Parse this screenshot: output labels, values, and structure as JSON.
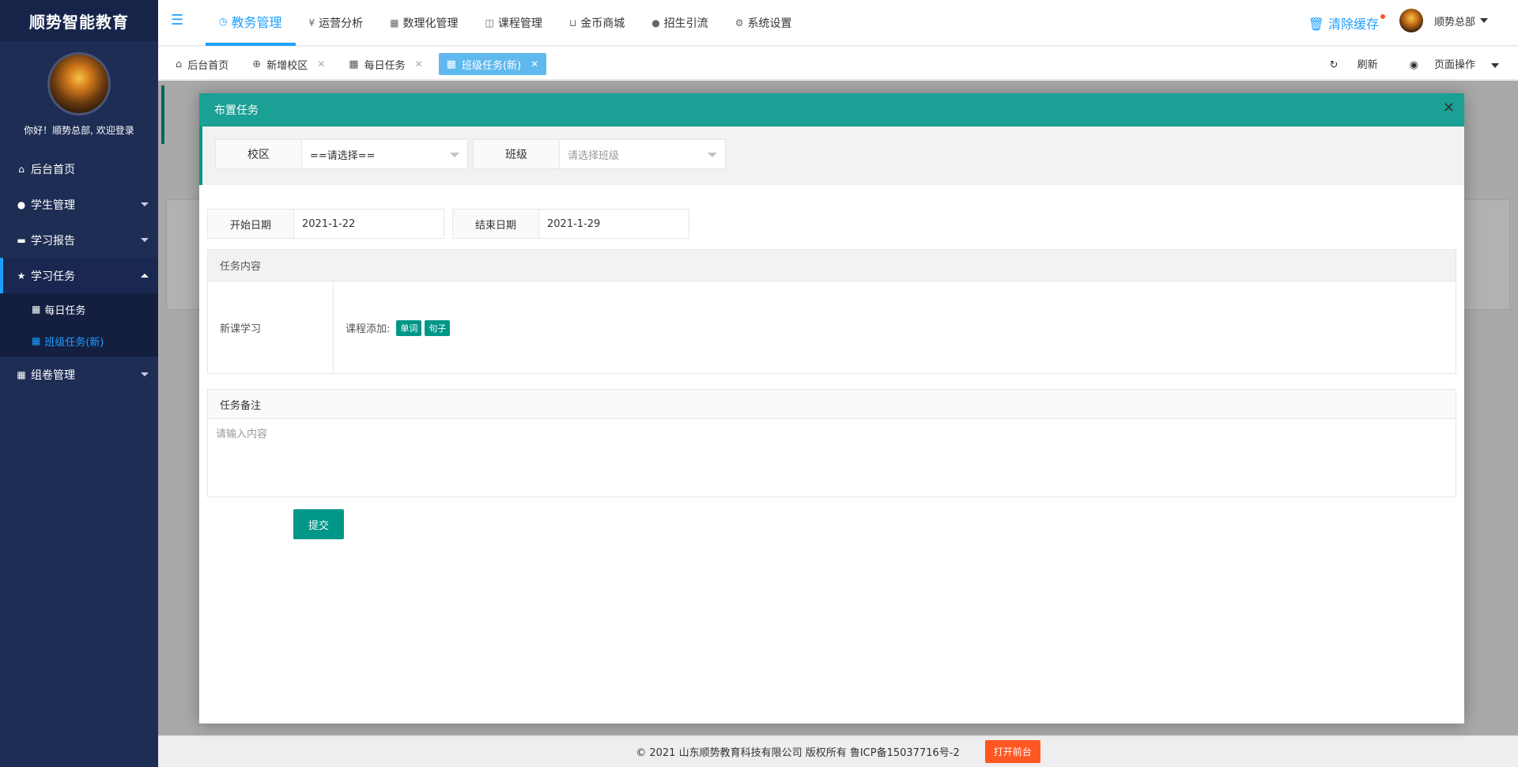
{
  "brand": "顺势智能教育",
  "welcome": "你好！顺势总部, 欢迎登录",
  "sidebar": {
    "items": [
      {
        "icon": "home-icon",
        "label": "后台首页"
      },
      {
        "icon": "user-icon",
        "label": "学生管理"
      },
      {
        "icon": "report-icon",
        "label": "学习报告"
      },
      {
        "icon": "star-icon",
        "label": "学习任务"
      },
      {
        "icon": "grid-icon",
        "label": "组卷管理"
      }
    ],
    "subitems": [
      {
        "icon": "grid-icon",
        "label": "每日任务"
      },
      {
        "icon": "grid-icon",
        "label": "班级任务(新)"
      }
    ]
  },
  "topnav": {
    "items": [
      {
        "icon": "clock-icon",
        "label": "教务管理"
      },
      {
        "icon": "yen-icon",
        "label": "运营分析"
      },
      {
        "icon": "grid-icon",
        "label": "数理化管理"
      },
      {
        "icon": "book-icon",
        "label": "课程管理"
      },
      {
        "icon": "cart-icon",
        "label": "金币商城"
      },
      {
        "icon": "users-icon",
        "label": "招生引流"
      },
      {
        "icon": "gear-icon",
        "label": "系统设置"
      }
    ],
    "clear_cache": "清除缓存",
    "user_name": "顺势总部"
  },
  "tabs": [
    {
      "icon": "home-icon",
      "label": "后台首页"
    },
    {
      "icon": "plus-circle-icon",
      "label": "新增校区"
    },
    {
      "icon": "grid-icon",
      "label": "每日任务"
    },
    {
      "icon": "grid-icon",
      "label": "班级任务(新)"
    }
  ],
  "tabops": {
    "refresh": "刷新",
    "page_ops": "页面操作"
  },
  "modal": {
    "title": "布置任务",
    "campus_label": "校区",
    "campus_value": "==请选择==",
    "class_label": "班级",
    "class_placeholder": "请选择班级",
    "start_label": "开始日期",
    "start_value": "2021-1-22",
    "end_label": "结束日期",
    "end_value": "2021-1-29",
    "task_content_label": "任务内容",
    "new_lesson_label": "新课学习",
    "course_add_label": "课程添加:",
    "tag_words": "单词",
    "tag_sentences": "句子",
    "note_label": "任务备注",
    "note_placeholder": "请输入内容",
    "submit": "提交"
  },
  "footer": {
    "copyright": "© 2021 山东顺势教育科技有限公司 版权所有 鲁ICP备15037716号-2",
    "open_front": "打开前台"
  },
  "colors": {
    "sidebar": "#1e2d54",
    "accent": "#1e9fff",
    "teal": "#009688",
    "modal_header": "#1aa094",
    "orange": "#ff5722"
  }
}
